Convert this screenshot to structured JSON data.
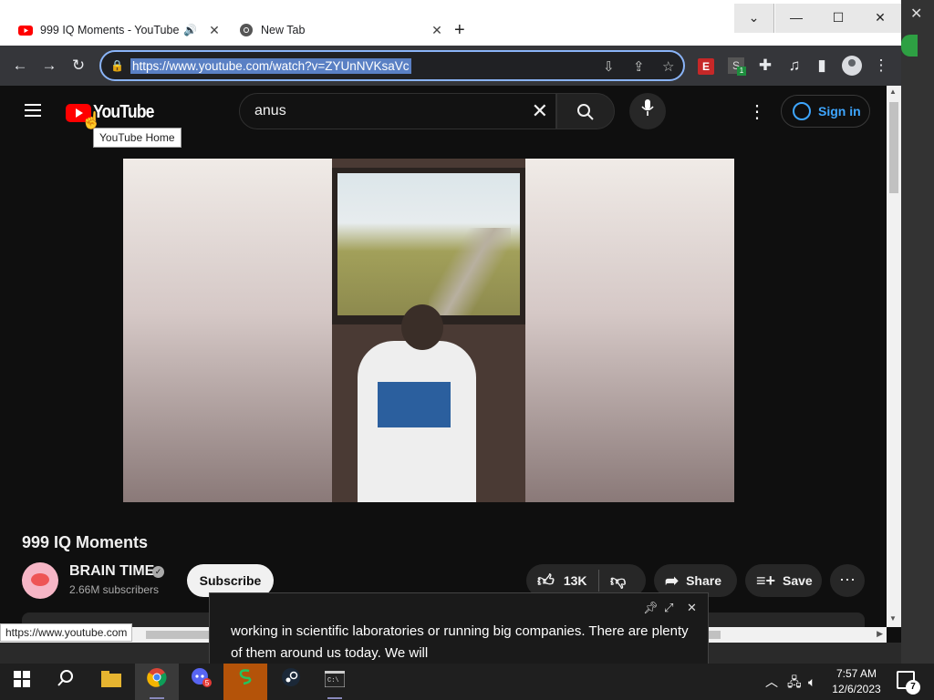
{
  "browser": {
    "tabs": [
      {
        "title": "999 IQ Moments - YouTube",
        "active": true
      },
      {
        "title": "New Tab",
        "active": false
      }
    ],
    "url": "https://www.youtube.com/watch?v=ZYUnNVKsaVc",
    "status_url": "https://www.youtube.com"
  },
  "youtube": {
    "logo_text": "YouTube",
    "logo_tooltip": "YouTube Home",
    "search_query": "anus",
    "sign_in": "Sign in",
    "video": {
      "title": "999 IQ Moments",
      "channel": "BRAIN TIME",
      "subscribers": "2.66M subscribers",
      "subscribe_label": "Subscribe",
      "likes": "13K",
      "share_label": "Share",
      "save_label": "Save"
    }
  },
  "caption": {
    "text": "working in scientific laboratories or running big companies. There are plenty of them around us today. We will"
  },
  "taskbar": {
    "time": "7:57 AM",
    "date": "12/6/2023",
    "notification_count": "7",
    "discord_badge": "5"
  },
  "colors": {
    "accent": "#8ab4f8",
    "youtube_red": "#ff0000",
    "signin_blue": "#3ea6ff"
  }
}
